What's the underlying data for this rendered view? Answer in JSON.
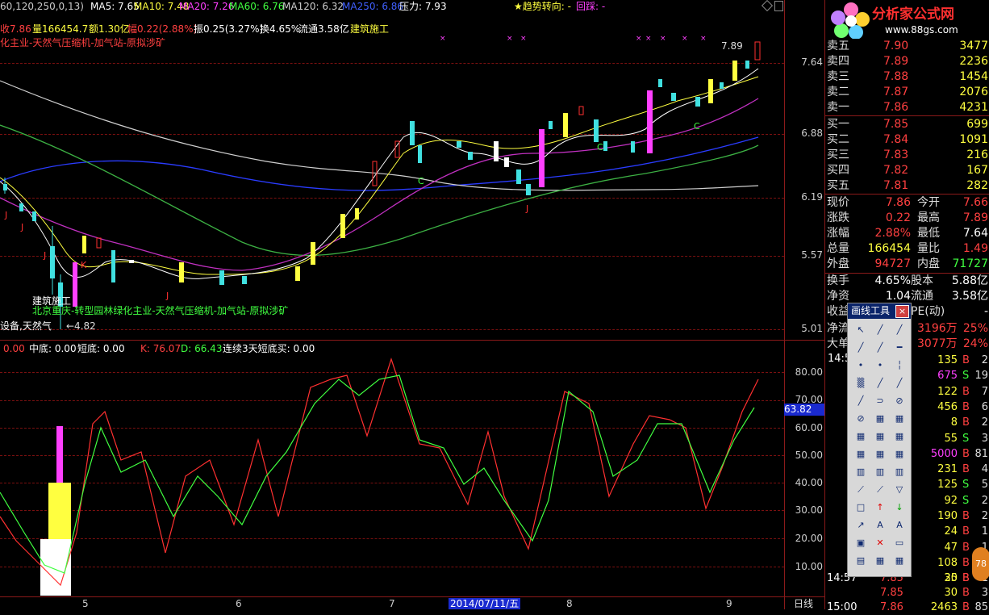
{
  "top_bar": {
    "prefix": "60,120,250,0,13)",
    "ma5": "MA5: 7.65",
    "ma10": "MA10: 7.48",
    "ma20": "MA20: 7.26",
    "ma60": "MA60: 6.76",
    "ma120": "MA120: 6.32",
    "ma250": "MA250: 6.86",
    "pressure": "压力: 7.93",
    "trend": "★趋势转向: -",
    "pullback": "回踩: -"
  },
  "info_bar": {
    "close": "收7.86",
    "volume": "量166454.7",
    "amount": "额1.30亿",
    "change": "幅0.22(2.88%)",
    "amplitude": "振0.25(3.27%)",
    "turnover": "换4.65%",
    "float": "流通3.58亿",
    "sector": "建筑施工"
  },
  "concept_top": "化主业-天然气压缩机-加气站-原拟涉矿",
  "concept_bottom": "北京重庆-转型园林绿化主业-天然气压缩机-加气站-原拟涉矿",
  "label_sector": "建筑施工",
  "label_device": "设备,天然气",
  "low_mark": "←4.82",
  "high_mark": "7.89",
  "price_axis": [
    "7.64",
    "6.88",
    "6.19",
    "5.57",
    "5.01"
  ],
  "indicator_bar": {
    "a": "0.00",
    "mid": "中底: 0.00",
    "short": "短底: 0.00",
    "k": "K: 76.07",
    "d": "D: 66.43",
    "cont": "连续3天短底买: 0.00"
  },
  "indicator_axis": [
    "80.00",
    "70.00",
    "60.00",
    "50.00",
    "40.00",
    "30.00",
    "20.00",
    "10.00"
  ],
  "indicator_current": "63.82",
  "date_axis": [
    "5",
    "6",
    "7",
    "8",
    "9"
  ],
  "date_highlight": "2014/07/11/五",
  "period_label": "日线",
  "signal_letters": [
    {
      "t": "J",
      "c": "#ff3030"
    },
    {
      "t": "J",
      "c": "#ff3030"
    },
    {
      "t": "J",
      "c": "#ff3030"
    },
    {
      "t": "K",
      "c": "#ff3030"
    },
    {
      "t": "J",
      "c": "#ff3030"
    },
    {
      "t": "C",
      "c": "#40ff40"
    },
    {
      "t": "J",
      "c": "#ff3030"
    },
    {
      "t": "C",
      "c": "#40ff40"
    },
    {
      "t": "C",
      "c": "#40ff40"
    }
  ],
  "logo": {
    "title": "分析家公式网",
    "url": "www.88gs.com"
  },
  "order_book": {
    "sell": [
      {
        "label": "卖五",
        "price": "7.90",
        "vol": "3477"
      },
      {
        "label": "卖四",
        "price": "7.89",
        "vol": "2236"
      },
      {
        "label": "卖三",
        "price": "7.88",
        "vol": "1454"
      },
      {
        "label": "卖二",
        "price": "7.87",
        "vol": "2076"
      },
      {
        "label": "卖一",
        "price": "7.86",
        "vol": "4231"
      }
    ],
    "buy": [
      {
        "label": "买一",
        "price": "7.85",
        "vol": "699"
      },
      {
        "label": "买二",
        "price": "7.84",
        "vol": "1091"
      },
      {
        "label": "买三",
        "price": "7.83",
        "vol": "216"
      },
      {
        "label": "买四",
        "price": "7.82",
        "vol": "167"
      },
      {
        "label": "买五",
        "price": "7.81",
        "vol": "282"
      }
    ]
  },
  "quote": [
    {
      "l1": "现价",
      "v1": "7.86",
      "c1": "#ff4040",
      "l2": "今开",
      "v2": "7.66",
      "c2": "#ff4040"
    },
    {
      "l1": "涨跌",
      "v1": "0.22",
      "c1": "#ff4040",
      "l2": "最高",
      "v2": "7.89",
      "c2": "#ff4040"
    },
    {
      "l1": "涨幅",
      "v1": "2.88%",
      "c1": "#ff4040",
      "l2": "最低",
      "v2": "7.64",
      "c2": "#ffffff"
    },
    {
      "l1": "总量",
      "v1": "166454",
      "c1": "#ffff40",
      "l2": "量比",
      "v2": "1.49",
      "c2": "#ff4040"
    },
    {
      "l1": "外盘",
      "v1": "94727",
      "c1": "#ff4040",
      "l2": "内盘",
      "v2": "71727",
      "c2": "#40ff40"
    }
  ],
  "quote2": [
    {
      "l1": "换手",
      "v1": "4.65%",
      "l2": "股本",
      "v2": "5.88亿"
    },
    {
      "l1": "净资",
      "v1": "1.04",
      "l2": "流通",
      "v2": "3.58亿"
    },
    {
      "l1": "收益",
      "v1": "",
      "l2": "PE(动)",
      "v2": "-"
    }
  ],
  "fund_rows": [
    {
      "l": "净流",
      "v": "3196万",
      "p": "25%"
    },
    {
      "l": "大单",
      "v": "3077万",
      "p": "24%"
    }
  ],
  "ticks_time": "14:5",
  "ticks": [
    {
      "v": "135",
      "bs": "B",
      "n": "2",
      "vc": "#ffff40"
    },
    {
      "v": "675",
      "bs": "S",
      "n": "19",
      "vc": "#ff40ff"
    },
    {
      "v": "122",
      "bs": "B",
      "n": "7",
      "vc": "#ffff40"
    },
    {
      "v": "456",
      "bs": "B",
      "n": "6",
      "vc": "#ffff40"
    },
    {
      "v": "8",
      "bs": "B",
      "n": "2",
      "vc": "#ffff40"
    },
    {
      "v": "55",
      "bs": "S",
      "n": "3",
      "vc": "#ffff40"
    },
    {
      "v": "5000",
      "bs": "B",
      "n": "81",
      "vc": "#ff40ff"
    },
    {
      "v": "231",
      "bs": "B",
      "n": "4",
      "vc": "#ffff40"
    },
    {
      "v": "125",
      "bs": "S",
      "n": "5",
      "vc": "#ffff40"
    },
    {
      "v": "92",
      "bs": "S",
      "n": "2",
      "vc": "#ffff40"
    },
    {
      "v": "190",
      "bs": "B",
      "n": "2",
      "vc": "#ffff40"
    },
    {
      "v": "24",
      "bs": "B",
      "n": "1",
      "vc": "#ffff40"
    },
    {
      "v": "47",
      "bs": "B",
      "n": "1",
      "vc": "#ffff40"
    },
    {
      "v": "108",
      "bs": "B",
      "n": "2",
      "vc": "#ffff40"
    },
    {
      "v": "20",
      "bs": "B",
      "n": "1",
      "vc": "#ffff40"
    }
  ],
  "tail_rows": [
    {
      "t": "14:57",
      "p": "7.85",
      "v": "35",
      "bs": "B",
      "n": "1"
    },
    {
      "t": "",
      "p": "7.85",
      "v": "30",
      "bs": "B",
      "n": "3"
    },
    {
      "t": "15:00",
      "p": "7.86",
      "v": "2463",
      "bs": "B",
      "n": "85"
    }
  ],
  "tool_panel": {
    "title": "画线工具",
    "close": "×"
  },
  "badge": "78"
}
